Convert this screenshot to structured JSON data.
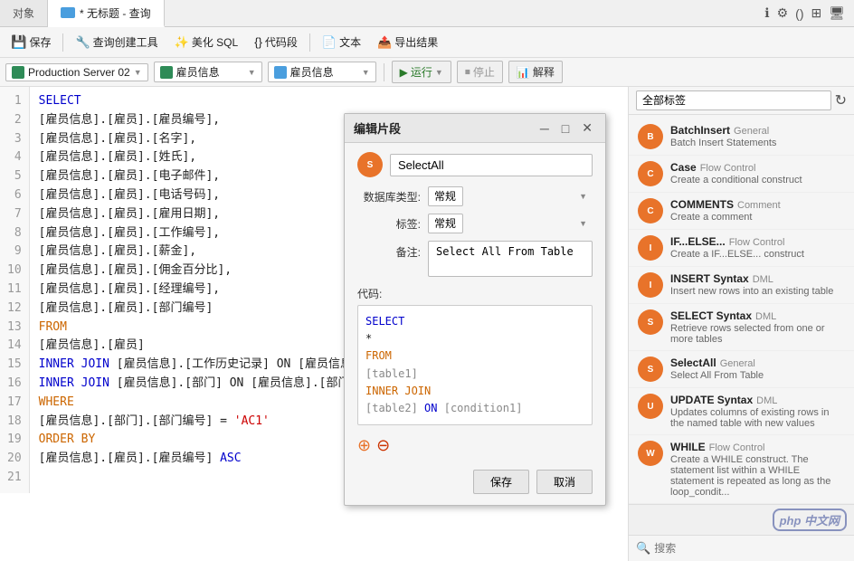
{
  "tabs": {
    "object_tab": "对象",
    "query_tab": "* 无标题 - 查询"
  },
  "toolbar": {
    "save": "保存",
    "query_builder": "查询创建工具",
    "beautify": "美化 SQL",
    "code_segment": "代码段",
    "text": "文本",
    "export": "导出结果"
  },
  "dbbar": {
    "server": "Production Server 02",
    "db1": "雇员信息",
    "db2": "雇员信息",
    "run": "运行",
    "stop": "停止",
    "explain": "解释"
  },
  "code_lines": [
    {
      "num": "1",
      "text": "SELECT"
    },
    {
      "num": "2",
      "text": "[雇员信息].[雇员].[雇员编号],"
    },
    {
      "num": "3",
      "text": "[雇员信息].[雇员].[名字],"
    },
    {
      "num": "4",
      "text": "[雇员信息].[雇员].[姓氏],"
    },
    {
      "num": "5",
      "text": "[雇员信息].[雇员].[电子邮件],"
    },
    {
      "num": "6",
      "text": "[雇员信息].[雇员].[电话号码],"
    },
    {
      "num": "7",
      "text": "[雇员信息].[雇员].[雇用日期],"
    },
    {
      "num": "8",
      "text": "[雇员信息].[雇员].[工作编号],"
    },
    {
      "num": "9",
      "text": "[雇员信息].[雇员].[薪金],"
    },
    {
      "num": "10",
      "text": "[雇员信息].[雇员].[佣金百分比],"
    },
    {
      "num": "11",
      "text": "[雇员信息].[雇员].[经理编号],"
    },
    {
      "num": "12",
      "text": "[雇员信息].[雇员].[部门编号]"
    },
    {
      "num": "13",
      "text": "FROM",
      "type": "kw-from"
    },
    {
      "num": "14",
      "text": "[雇员信息].[雇员]"
    },
    {
      "num": "15",
      "text": "INNER JOIN [雇员信息].[工作历史记录] ON [雇员信息].[工作..."
    },
    {
      "num": "16",
      "text": "INNER JOIN [雇员信息].[部门] ON [雇员信息].[部门].[部门编..."
    },
    {
      "num": "17",
      "text": "WHERE",
      "type": "kw-from"
    },
    {
      "num": "18",
      "text": "[雇员信息].[部门].[部门编号] = 'AC1'"
    },
    {
      "num": "19",
      "text": "ORDER BY",
      "type": "kw-from"
    },
    {
      "num": "20",
      "text": "[雇员信息].[雇员].[雇员编号] ASC"
    },
    {
      "num": "21",
      "text": ""
    }
  ],
  "right_panel": {
    "tag_label": "全部标签",
    "search_placeholder": "搜索",
    "snippets": [
      {
        "name": "BatchInsert",
        "tag": "General",
        "desc": "Batch Insert Statements"
      },
      {
        "name": "Case",
        "tag": "Flow Control",
        "desc": "Create a conditional construct"
      },
      {
        "name": "COMMENTS",
        "tag": "Comment",
        "desc": "Create a comment"
      },
      {
        "name": "IF...ELSE...",
        "tag": "Flow Control",
        "desc": "Create a IF...ELSE... construct"
      },
      {
        "name": "INSERT Syntax",
        "tag": "DML",
        "desc": "Insert new rows into an existing table"
      },
      {
        "name": "SELECT Syntax",
        "tag": "DML",
        "desc": "Retrieve rows selected from one or more tables"
      },
      {
        "name": "SelectAll",
        "tag": "General",
        "desc": "Select All From Table"
      },
      {
        "name": "UPDATE Syntax",
        "tag": "DML",
        "desc": "Updates columns of existing rows in the named table with new values"
      },
      {
        "name": "WHILE",
        "tag": "Flow Control",
        "desc": "Create a WHILE construct. The statement list within a WHILE statement is repeated as long as the loop_condit..."
      }
    ]
  },
  "modal": {
    "title": "编辑片段",
    "name_value": "SelectAll",
    "db_type_label": "数据库类型:",
    "db_type_value": "常规",
    "tag_label": "标签:",
    "tag_value": "常规",
    "note_label": "备注:",
    "note_value": "Select All From Table",
    "code_label": "代码:",
    "save_btn": "保存",
    "cancel_btn": "取消",
    "code_lines": [
      {
        "text": "SELECT",
        "type": "kw"
      },
      {
        "text": "*",
        "type": "plain"
      },
      {
        "text": "FROM",
        "type": "kw-from"
      },
      {
        "text": "  [table1]",
        "type": "plain"
      },
      {
        "text": "INNER JOIN",
        "type": "kw-join"
      },
      {
        "text": "  [table2] ON [condition1]",
        "type": "plain"
      }
    ]
  },
  "php_logo": "php 中文网"
}
